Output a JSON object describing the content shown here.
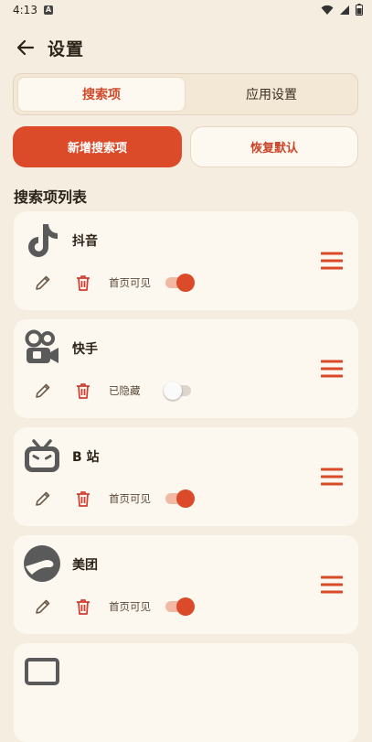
{
  "status_bar": {
    "time": "4:13",
    "notification_icon": "A"
  },
  "appbar": {
    "title": "设置"
  },
  "tabs": [
    {
      "label": "搜索项",
      "active": true
    },
    {
      "label": "应用设置",
      "active": false
    }
  ],
  "buttons": {
    "add": "新增搜索项",
    "reset": "恢复默认"
  },
  "section_title": "搜索项列表",
  "items": [
    {
      "name": "抖音",
      "icon": "douyin-logo",
      "visibility_label": "首页可见",
      "enabled": true
    },
    {
      "name": "快手",
      "icon": "kuaishou-logo",
      "visibility_label": "已隐藏",
      "enabled": false
    },
    {
      "name": "B 站",
      "icon": "bilibili-logo",
      "visibility_label": "首页可见",
      "enabled": true
    },
    {
      "name": "美团",
      "icon": "meituan-logo",
      "visibility_label": "首页可见",
      "enabled": true
    }
  ],
  "colors": {
    "accent": "#dc4b29",
    "background": "#f5ede0",
    "card": "#fdf8ef"
  }
}
